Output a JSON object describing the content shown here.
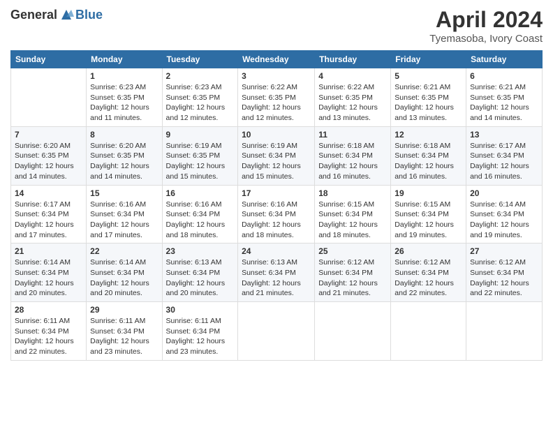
{
  "header": {
    "logo": {
      "text_general": "General",
      "text_blue": "Blue"
    },
    "title": "April 2024",
    "location": "Tyemasoba, Ivory Coast"
  },
  "weekdays": [
    "Sunday",
    "Monday",
    "Tuesday",
    "Wednesday",
    "Thursday",
    "Friday",
    "Saturday"
  ],
  "weeks": [
    [
      {
        "day": "",
        "sunrise": "",
        "sunset": "",
        "daylight": ""
      },
      {
        "day": "1",
        "sunrise": "Sunrise: 6:23 AM",
        "sunset": "Sunset: 6:35 PM",
        "daylight": "Daylight: 12 hours and 11 minutes."
      },
      {
        "day": "2",
        "sunrise": "Sunrise: 6:23 AM",
        "sunset": "Sunset: 6:35 PM",
        "daylight": "Daylight: 12 hours and 12 minutes."
      },
      {
        "day": "3",
        "sunrise": "Sunrise: 6:22 AM",
        "sunset": "Sunset: 6:35 PM",
        "daylight": "Daylight: 12 hours and 12 minutes."
      },
      {
        "day": "4",
        "sunrise": "Sunrise: 6:22 AM",
        "sunset": "Sunset: 6:35 PM",
        "daylight": "Daylight: 12 hours and 13 minutes."
      },
      {
        "day": "5",
        "sunrise": "Sunrise: 6:21 AM",
        "sunset": "Sunset: 6:35 PM",
        "daylight": "Daylight: 12 hours and 13 minutes."
      },
      {
        "day": "6",
        "sunrise": "Sunrise: 6:21 AM",
        "sunset": "Sunset: 6:35 PM",
        "daylight": "Daylight: 12 hours and 14 minutes."
      }
    ],
    [
      {
        "day": "7",
        "sunrise": "Sunrise: 6:20 AM",
        "sunset": "Sunset: 6:35 PM",
        "daylight": "Daylight: 12 hours and 14 minutes."
      },
      {
        "day": "8",
        "sunrise": "Sunrise: 6:20 AM",
        "sunset": "Sunset: 6:35 PM",
        "daylight": "Daylight: 12 hours and 14 minutes."
      },
      {
        "day": "9",
        "sunrise": "Sunrise: 6:19 AM",
        "sunset": "Sunset: 6:35 PM",
        "daylight": "Daylight: 12 hours and 15 minutes."
      },
      {
        "day": "10",
        "sunrise": "Sunrise: 6:19 AM",
        "sunset": "Sunset: 6:34 PM",
        "daylight": "Daylight: 12 hours and 15 minutes."
      },
      {
        "day": "11",
        "sunrise": "Sunrise: 6:18 AM",
        "sunset": "Sunset: 6:34 PM",
        "daylight": "Daylight: 12 hours and 16 minutes."
      },
      {
        "day": "12",
        "sunrise": "Sunrise: 6:18 AM",
        "sunset": "Sunset: 6:34 PM",
        "daylight": "Daylight: 12 hours and 16 minutes."
      },
      {
        "day": "13",
        "sunrise": "Sunrise: 6:17 AM",
        "sunset": "Sunset: 6:34 PM",
        "daylight": "Daylight: 12 hours and 16 minutes."
      }
    ],
    [
      {
        "day": "14",
        "sunrise": "Sunrise: 6:17 AM",
        "sunset": "Sunset: 6:34 PM",
        "daylight": "Daylight: 12 hours and 17 minutes."
      },
      {
        "day": "15",
        "sunrise": "Sunrise: 6:16 AM",
        "sunset": "Sunset: 6:34 PM",
        "daylight": "Daylight: 12 hours and 17 minutes."
      },
      {
        "day": "16",
        "sunrise": "Sunrise: 6:16 AM",
        "sunset": "Sunset: 6:34 PM",
        "daylight": "Daylight: 12 hours and 18 minutes."
      },
      {
        "day": "17",
        "sunrise": "Sunrise: 6:16 AM",
        "sunset": "Sunset: 6:34 PM",
        "daylight": "Daylight: 12 hours and 18 minutes."
      },
      {
        "day": "18",
        "sunrise": "Sunrise: 6:15 AM",
        "sunset": "Sunset: 6:34 PM",
        "daylight": "Daylight: 12 hours and 18 minutes."
      },
      {
        "day": "19",
        "sunrise": "Sunrise: 6:15 AM",
        "sunset": "Sunset: 6:34 PM",
        "daylight": "Daylight: 12 hours and 19 minutes."
      },
      {
        "day": "20",
        "sunrise": "Sunrise: 6:14 AM",
        "sunset": "Sunset: 6:34 PM",
        "daylight": "Daylight: 12 hours and 19 minutes."
      }
    ],
    [
      {
        "day": "21",
        "sunrise": "Sunrise: 6:14 AM",
        "sunset": "Sunset: 6:34 PM",
        "daylight": "Daylight: 12 hours and 20 minutes."
      },
      {
        "day": "22",
        "sunrise": "Sunrise: 6:14 AM",
        "sunset": "Sunset: 6:34 PM",
        "daylight": "Daylight: 12 hours and 20 minutes."
      },
      {
        "day": "23",
        "sunrise": "Sunrise: 6:13 AM",
        "sunset": "Sunset: 6:34 PM",
        "daylight": "Daylight: 12 hours and 20 minutes."
      },
      {
        "day": "24",
        "sunrise": "Sunrise: 6:13 AM",
        "sunset": "Sunset: 6:34 PM",
        "daylight": "Daylight: 12 hours and 21 minutes."
      },
      {
        "day": "25",
        "sunrise": "Sunrise: 6:12 AM",
        "sunset": "Sunset: 6:34 PM",
        "daylight": "Daylight: 12 hours and 21 minutes."
      },
      {
        "day": "26",
        "sunrise": "Sunrise: 6:12 AM",
        "sunset": "Sunset: 6:34 PM",
        "daylight": "Daylight: 12 hours and 22 minutes."
      },
      {
        "day": "27",
        "sunrise": "Sunrise: 6:12 AM",
        "sunset": "Sunset: 6:34 PM",
        "daylight": "Daylight: 12 hours and 22 minutes."
      }
    ],
    [
      {
        "day": "28",
        "sunrise": "Sunrise: 6:11 AM",
        "sunset": "Sunset: 6:34 PM",
        "daylight": "Daylight: 12 hours and 22 minutes."
      },
      {
        "day": "29",
        "sunrise": "Sunrise: 6:11 AM",
        "sunset": "Sunset: 6:34 PM",
        "daylight": "Daylight: 12 hours and 23 minutes."
      },
      {
        "day": "30",
        "sunrise": "Sunrise: 6:11 AM",
        "sunset": "Sunset: 6:34 PM",
        "daylight": "Daylight: 12 hours and 23 minutes."
      },
      {
        "day": "",
        "sunrise": "",
        "sunset": "",
        "daylight": ""
      },
      {
        "day": "",
        "sunrise": "",
        "sunset": "",
        "daylight": ""
      },
      {
        "day": "",
        "sunrise": "",
        "sunset": "",
        "daylight": ""
      },
      {
        "day": "",
        "sunrise": "",
        "sunset": "",
        "daylight": ""
      }
    ]
  ]
}
